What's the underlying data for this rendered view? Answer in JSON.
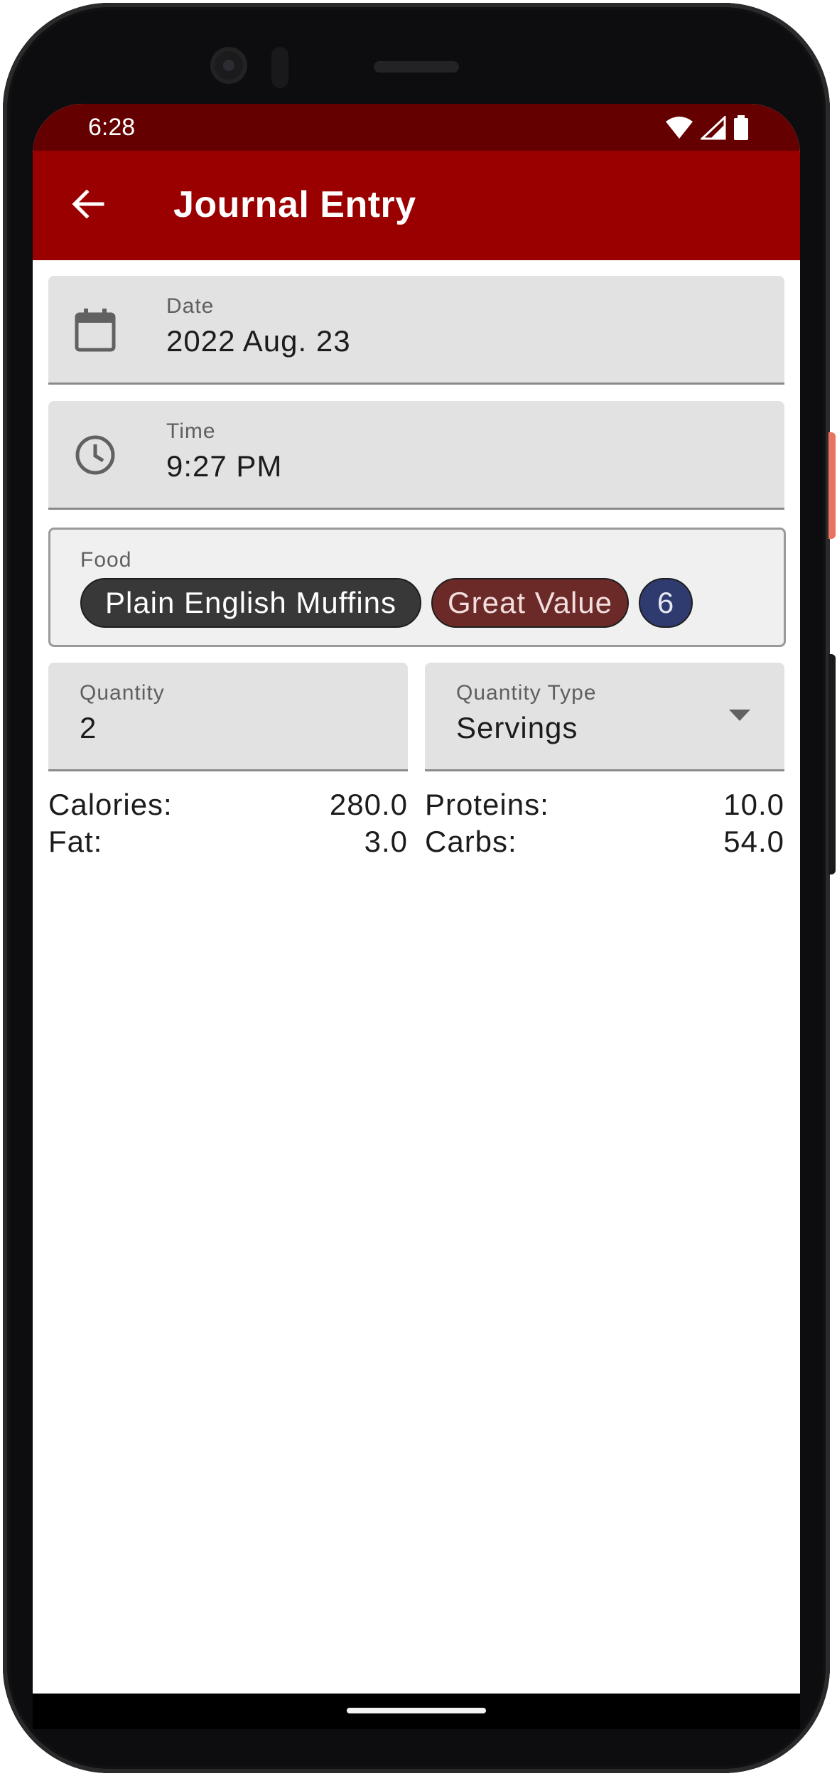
{
  "status_bar": {
    "time": "6:28",
    "icons": [
      "wifi-icon",
      "signal-icon",
      "battery-icon"
    ]
  },
  "app_bar": {
    "title": "Journal Entry",
    "back_icon": "arrow-back-icon",
    "color": "#9b0000"
  },
  "form": {
    "date": {
      "label": "Date",
      "value": "2022 Aug. 23",
      "icon": "calendar-icon"
    },
    "time": {
      "label": "Time",
      "value": "9:27 PM",
      "icon": "clock-icon"
    },
    "food": {
      "label": "Food",
      "name_chip": "Plain English Muffins",
      "brand_chip": "Great Value",
      "count_chip": "6"
    },
    "quantity": {
      "label": "Quantity",
      "value": "2"
    },
    "quantity_type": {
      "label": "Quantity Type",
      "value": "Servings",
      "icon": "dropdown-arrow-icon"
    }
  },
  "nutrition": {
    "calories_label": "Calories:",
    "calories_value": "280.0",
    "fat_label": "Fat:",
    "fat_value": "3.0",
    "proteins_label": "Proteins:",
    "proteins_value": "10.0",
    "carbs_label": "Carbs:",
    "carbs_value": "54.0"
  }
}
